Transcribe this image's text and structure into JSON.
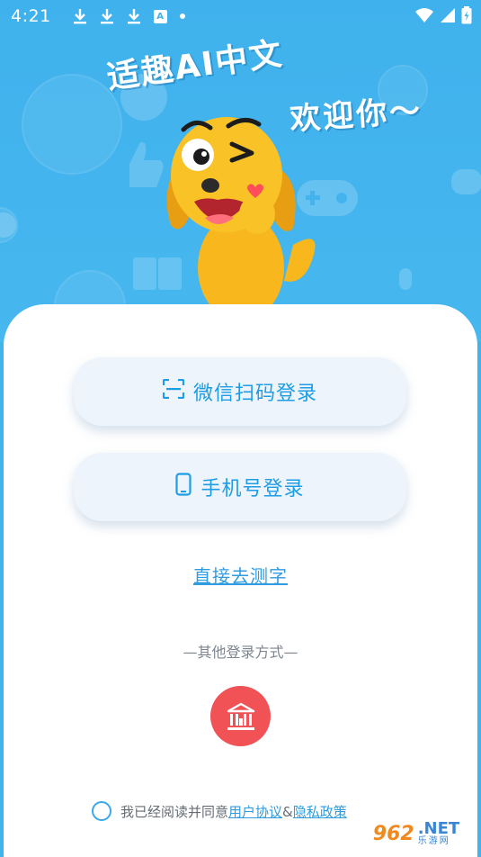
{
  "status_bar": {
    "time": "4:21",
    "badge_letter": "A"
  },
  "hero": {
    "title_line1": "适趣AI中文",
    "title_line2": "欢迎你～",
    "mascot": "dog-mascot"
  },
  "login": {
    "wechat_label": "微信扫码登录",
    "wechat_icon": "scan-icon",
    "phone_label": "手机号登录",
    "phone_icon": "phone-icon",
    "direct_link": "直接去测字"
  },
  "other": {
    "label": "—其他登录方式—",
    "gov_icon": "government-building-icon",
    "gov_color": "#f05256"
  },
  "agreement": {
    "prefix": "我已经阅读并同意",
    "user_agreement": "用户协议",
    "amp": "&",
    "privacy_policy": "隐私政策"
  },
  "watermark": {
    "number": "962",
    "suffix": ".NET",
    "sub": "乐游网"
  },
  "colors": {
    "sky": "#41b3ec",
    "accent": "#1d9de5",
    "button_bg": "#eef4fb"
  }
}
